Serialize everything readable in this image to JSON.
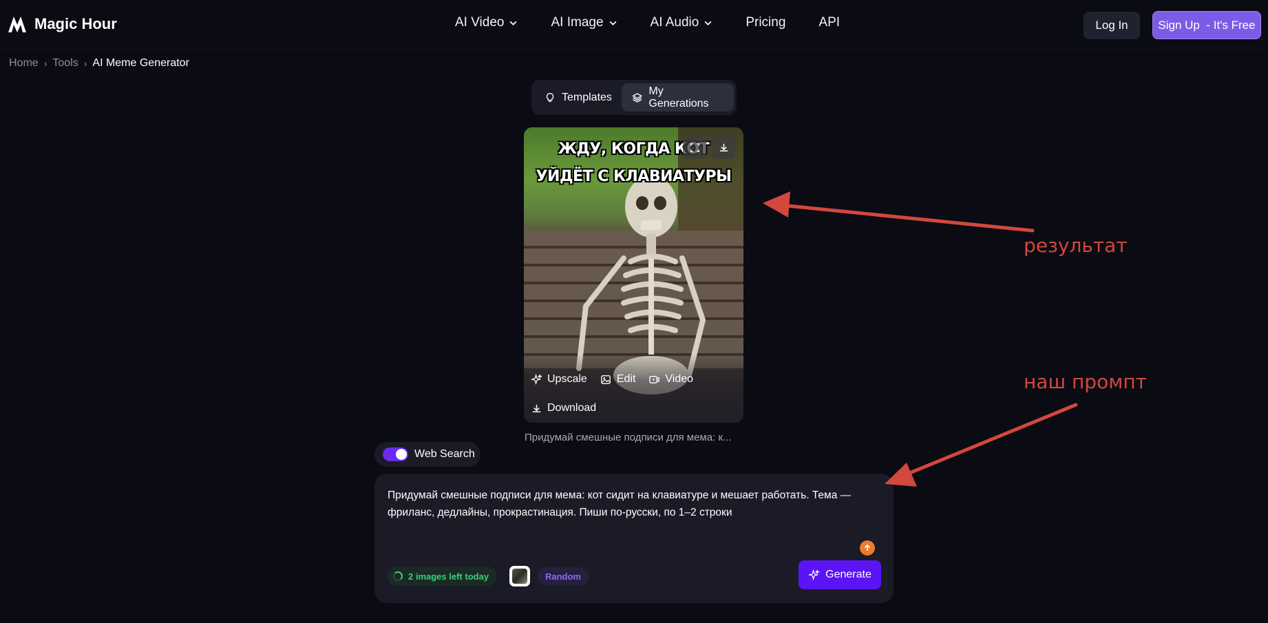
{
  "header": {
    "logo_text": "Magic Hour",
    "nav": [
      {
        "label": "AI Video",
        "has_dropdown": true
      },
      {
        "label": "AI Image",
        "has_dropdown": true
      },
      {
        "label": "AI Audio",
        "has_dropdown": true
      },
      {
        "label": "Pricing",
        "has_dropdown": false
      },
      {
        "label": "API",
        "has_dropdown": false
      }
    ],
    "login_label": "Log In",
    "signup_label": "Sign Up  - It's Free"
  },
  "breadcrumb": {
    "items": [
      "Home",
      "Tools"
    ],
    "current": "AI Meme Generator"
  },
  "tabs": {
    "templates_label": "Templates",
    "generations_label": "My Generations",
    "active": "My Generations"
  },
  "result": {
    "meme_text": "ЖДУ, КОГДА КОТ УЙДЁТ С КЛАВИАТУРЫ",
    "actions": {
      "upscale": "Upscale",
      "edit": "Edit",
      "video": "Video",
      "download": "Download"
    },
    "caption": "Придумай смешные подписи для мема: к..."
  },
  "web_search": {
    "label": "Web Search",
    "enabled": true
  },
  "prompt": {
    "text": "Придумай смешные подписи для мема: кот сидит на клавиатуре и мешает работать. Тема — фриланс, дедлайны, прокрастинация. Пиши по-русски, по 1–2 строки",
    "images_left": "2 images left today",
    "random_label": "Random",
    "generate_label": "Generate"
  },
  "annotations": {
    "result_label": "результат",
    "prompt_label": "наш промпт",
    "color": "#d2483c"
  },
  "colors": {
    "background": "#0b0b14",
    "accent": "#5a14f5",
    "signup": "#7c5ce6",
    "panel": "#1a1b26",
    "success": "#38d07a"
  }
}
